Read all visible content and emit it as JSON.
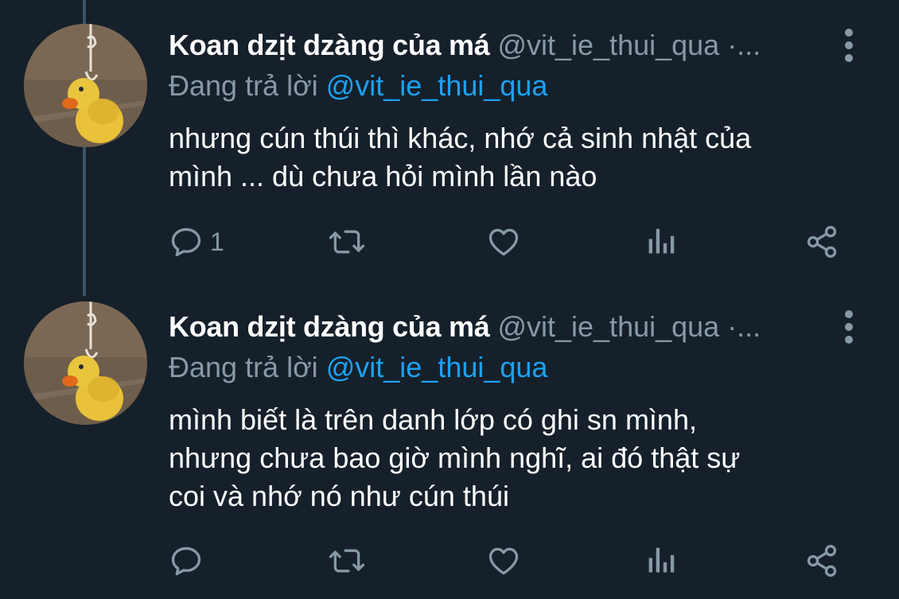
{
  "colors": {
    "background": "#15202b",
    "text_primary": "#ffffff",
    "text_secondary": "#8899a6",
    "accent_link": "#1da1f2",
    "thread_line": "#3d5466"
  },
  "tweets": [
    {
      "display_name": "Koan dzịt dzàng của má",
      "handle": "@vit_ie_thui_qua ·...",
      "reply_prefix": "Đang trả lời",
      "reply_mention": "@vit_ie_thui_qua",
      "text_lines": [
        "nhưng cún thúi thì khác, nhớ cả sinh nhật của",
        "mình ... dù chưa hỏi mình lần nào"
      ],
      "reply_count": "1",
      "icons": {
        "reply": "reply-icon",
        "retweet": "retweet-icon",
        "like": "heart-icon",
        "analytics": "analytics-icon",
        "share": "share-icon",
        "more": "more-vertical-icon"
      }
    },
    {
      "display_name": "Koan dzịt dzàng của má",
      "handle": "@vit_ie_thui_qua ·...",
      "reply_prefix": "Đang trả lời",
      "reply_mention": "@vit_ie_thui_qua",
      "text_lines": [
        "mình biết là trên danh lớp có ghi sn mình,",
        "nhưng chưa bao giờ mình nghĩ, ai đó thật sự",
        "coi và nhớ nó như cún thúi"
      ],
      "reply_count": "",
      "icons": {
        "reply": "reply-icon",
        "retweet": "retweet-icon",
        "like": "heart-icon",
        "analytics": "analytics-icon",
        "share": "share-icon",
        "more": "more-vertical-icon"
      }
    }
  ]
}
